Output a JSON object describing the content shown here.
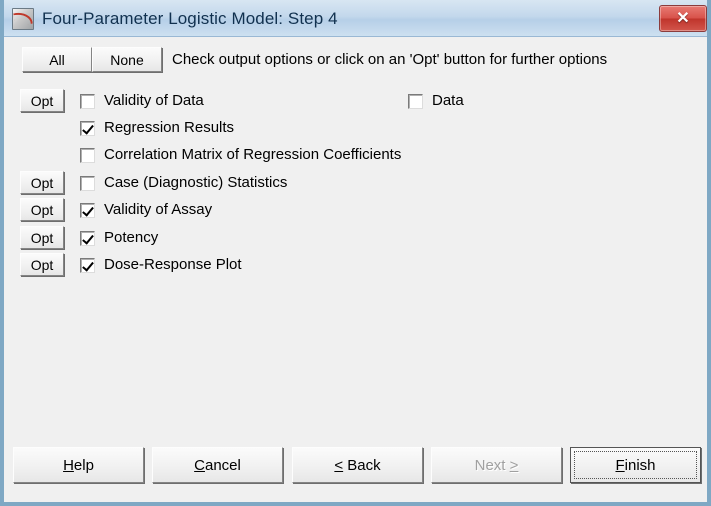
{
  "window": {
    "title": "Four-Parameter Logistic Model: Step 4",
    "icon": "app-chart-icon",
    "close_label": "✕",
    "titlebar_color": "#bcd3ea",
    "body_color": "#f0f0f0",
    "frame_color": "#7fa8c4",
    "close_color": "#c0352c"
  },
  "toolbar": {
    "all_label": "All",
    "none_label": "None",
    "hint": "Check output options or click on an 'Opt' button for further options"
  },
  "options": {
    "opt_label": "Opt",
    "rows": [
      {
        "label": "Validity of Data",
        "checked": false,
        "has_opt": true
      },
      {
        "label": "Regression Results",
        "checked": true,
        "has_opt": false
      },
      {
        "label": "Correlation Matrix of Regression Coefficients",
        "checked": false,
        "has_opt": false
      },
      {
        "label": "Case (Diagnostic) Statistics",
        "checked": false,
        "has_opt": true
      },
      {
        "label": "Validity of Assay",
        "checked": true,
        "has_opt": true
      },
      {
        "label": "Potency",
        "checked": true,
        "has_opt": true
      },
      {
        "label": "Dose-Response Plot",
        "checked": true,
        "has_opt": true
      }
    ],
    "right_column": [
      {
        "label": "Data",
        "checked": false
      }
    ]
  },
  "footer": {
    "buttons": [
      {
        "label": "Help",
        "accel": "H",
        "accel_index": 0,
        "disabled": false,
        "default": false
      },
      {
        "label": "Cancel",
        "accel": "C",
        "accel_index": 0,
        "disabled": false,
        "default": false
      },
      {
        "label": "< Back",
        "accel": "<",
        "accel_index": 0,
        "disabled": false,
        "default": false
      },
      {
        "label": "Next >",
        "accel": ">",
        "accel_index": 5,
        "disabled": true,
        "default": false
      },
      {
        "label": "Finish",
        "accel": "F",
        "accel_index": 0,
        "disabled": false,
        "default": true
      }
    ]
  }
}
